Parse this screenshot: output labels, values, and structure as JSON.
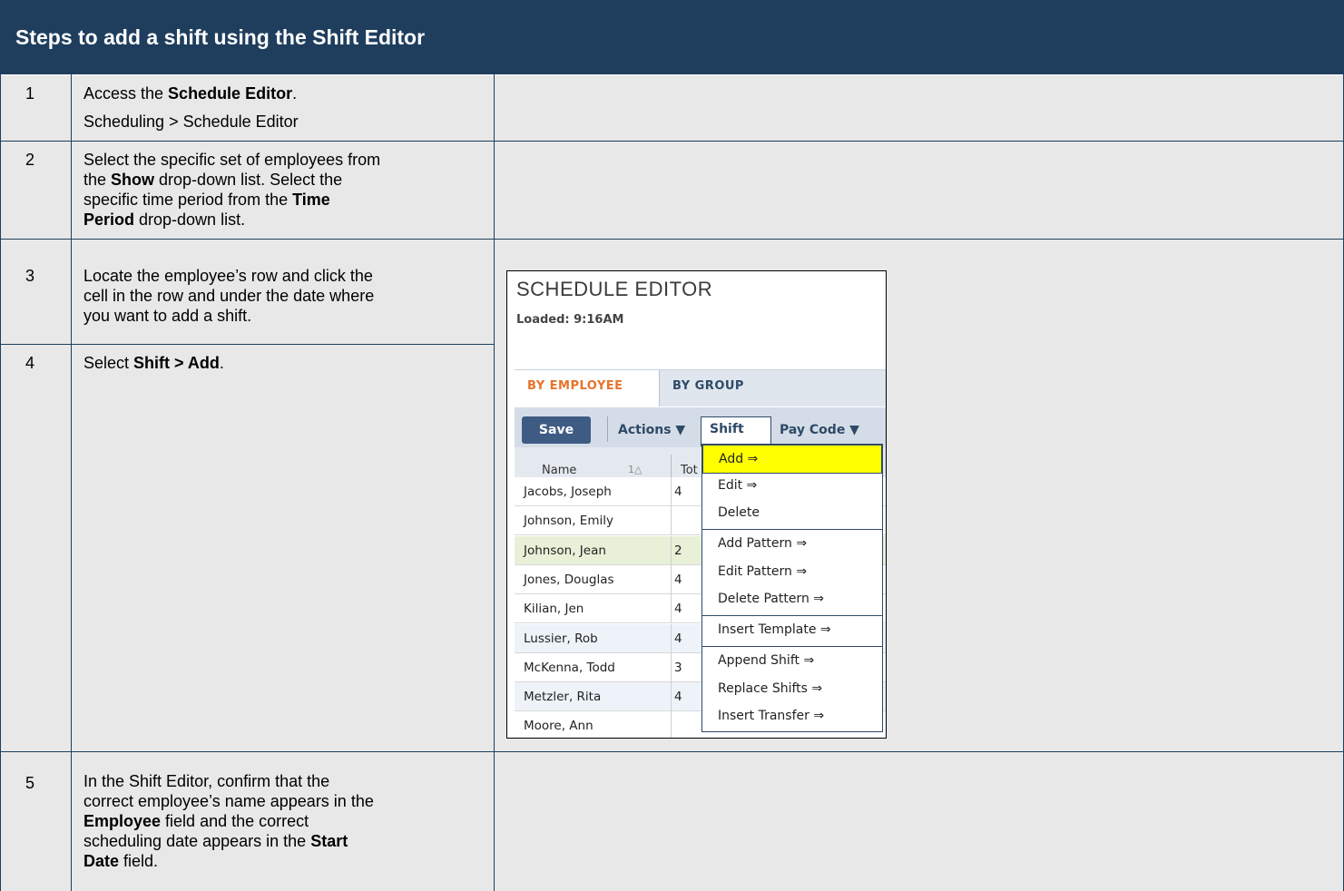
{
  "header": {
    "title": "Steps to add a shift using the Shift Editor"
  },
  "steps": [
    {
      "num": "1",
      "line1_pre": "Access the ",
      "line1_bold": "Schedule Editor",
      "line1_post": ".",
      "line2": "Scheduling > Schedule Editor"
    },
    {
      "num": "2",
      "l1": "Select the specific set of employees from",
      "l2_pre": "the ",
      "l2_bold": "Show",
      "l2_post": " drop-down list. Select the",
      "l3_pre": "specific time period from the ",
      "l3_bold": "Time",
      "l4_bold": "Period",
      "l4_post": " drop-down list."
    },
    {
      "num": "3",
      "l1": "Locate the employee’s row and click the",
      "l2": "cell in the row and under the date where",
      "l3": "you want to add a shift."
    },
    {
      "num": "4",
      "pre": "Select ",
      "bold": "Shift > Add",
      "post": "."
    },
    {
      "num": "5",
      "l1": "In the Shift Editor, confirm that the",
      "l2": "correct employee’s name appears in the",
      "l3_bold": "Employee",
      "l3_post": " field and the correct",
      "l4_pre": "scheduling date appears in the ",
      "l4_bold": "Start",
      "l5_bold": "Date",
      "l5_post": " field."
    }
  ],
  "screenshot": {
    "title": "SCHEDULE EDITOR",
    "loaded": "Loaded: 9:16AM",
    "tabs": {
      "by_employee": "BY EMPLOYEE",
      "by_group": "BY GROUP"
    },
    "toolbar": {
      "save": "Save",
      "actions": "Actions ▼",
      "shift": "Shift",
      "pay_code": "Pay Code ▼"
    },
    "grid_header": {
      "name": "Name",
      "sort": "1△",
      "total": "Tot"
    },
    "rows": [
      {
        "name": "Jacobs, Joseph",
        "tot": "4"
      },
      {
        "name": "Johnson, Emily",
        "tot": ""
      },
      {
        "name": "Johnson, Jean",
        "tot": "2"
      },
      {
        "name": "Jones, Douglas",
        "tot": "4"
      },
      {
        "name": "Kilian, Jen",
        "tot": "4"
      },
      {
        "name": "Lussier, Rob",
        "tot": "4"
      },
      {
        "name": "McKenna, Todd",
        "tot": "3"
      },
      {
        "name": "Metzler, Rita",
        "tot": "4"
      },
      {
        "name": "Moore, Ann",
        "tot": ""
      }
    ],
    "row_colors": [
      "#ffffff",
      "#ffffff",
      "#e8f0d8",
      "#ffffff",
      "#ffffff",
      "#eef3fa",
      "#ffffff",
      "#eef3fa",
      "#ffffff"
    ],
    "menu_items": [
      "Add ⇒",
      "Edit ⇒",
      "Delete",
      "Add Pattern ⇒",
      "Edit Pattern ⇒",
      "Delete Pattern ⇒",
      "Insert Template ⇒",
      "Append Shift ⇒",
      "Replace Shifts ⇒",
      "Insert Transfer ⇒"
    ],
    "highlight_color": "#ffff00"
  }
}
